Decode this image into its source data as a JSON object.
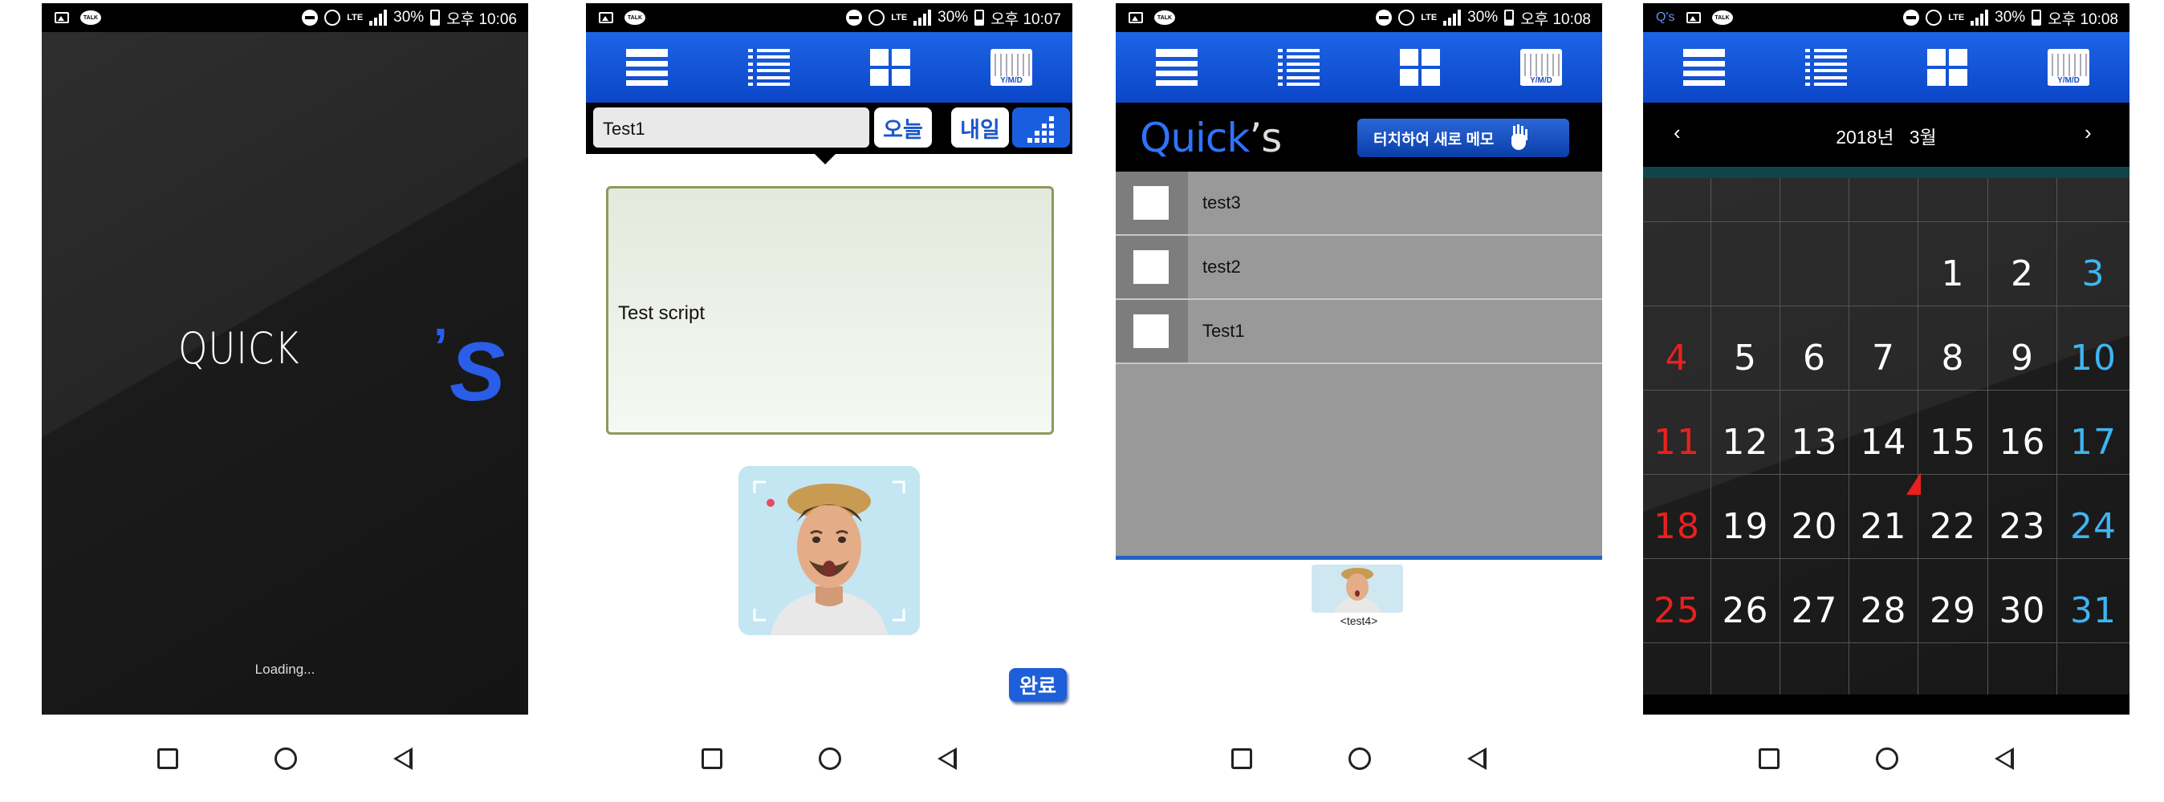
{
  "status_bars": [
    {
      "talk": "TALK",
      "lte": "LTE",
      "battery": "30%",
      "time": "오후 10:06"
    },
    {
      "talk": "TALK",
      "lte": "LTE",
      "battery": "30%",
      "time": "오후 10:07"
    },
    {
      "talk": "TALK",
      "lte": "LTE",
      "battery": "30%",
      "time": "오후 10:08"
    },
    {
      "talk": "TALK",
      "lte": "LTE",
      "battery": "30%",
      "time": "오후 10:08",
      "app_icon": "Q's"
    }
  ],
  "splash": {
    "logo_word": "QUICK",
    "logo_apostrophe": "’",
    "logo_s": "S",
    "loading_text": "Loading..."
  },
  "toolbar": {
    "calendar_icon_label": "Y/M/D",
    "icons": [
      "list-detail-icon",
      "list-icon",
      "grid-icon",
      "calendar-icon"
    ]
  },
  "editor": {
    "title_value": "Test1",
    "today_label": "오늘",
    "tomorrow_label": "내일",
    "note_text": "Test script",
    "done_label": "완료"
  },
  "memo_list": {
    "logo_main": "Quick",
    "logo_suffix": "’s",
    "new_memo_label": "터치하여 새로 메모",
    "items": [
      {
        "label": "test3"
      },
      {
        "label": "test2"
      },
      {
        "label": "Test1"
      }
    ],
    "thumb_label": "<test4>"
  },
  "calendar": {
    "prev": "‹",
    "next": "›",
    "month_label": "2018년   3월",
    "weeks": [
      [
        "",
        "",
        "",
        "",
        "1",
        "2",
        "3"
      ],
      [
        "4",
        "5",
        "6",
        "7",
        "8",
        "9",
        "10"
      ],
      [
        "11",
        "12",
        "13",
        "14",
        "15",
        "16",
        "17"
      ],
      [
        "18",
        "19",
        "20",
        "21",
        "22",
        "23",
        "24"
      ],
      [
        "25",
        "26",
        "27",
        "28",
        "29",
        "30",
        "31"
      ]
    ],
    "colors": {
      "sunday": "#e8211d",
      "saturday": "#3fb4f2",
      "first_sunday": "#23a4c4",
      "weekday": "#ffffff"
    }
  },
  "colors": {
    "accent_blue": "#0b46c8",
    "list_gray": "#999999",
    "note_border": "#8c9a5e"
  }
}
